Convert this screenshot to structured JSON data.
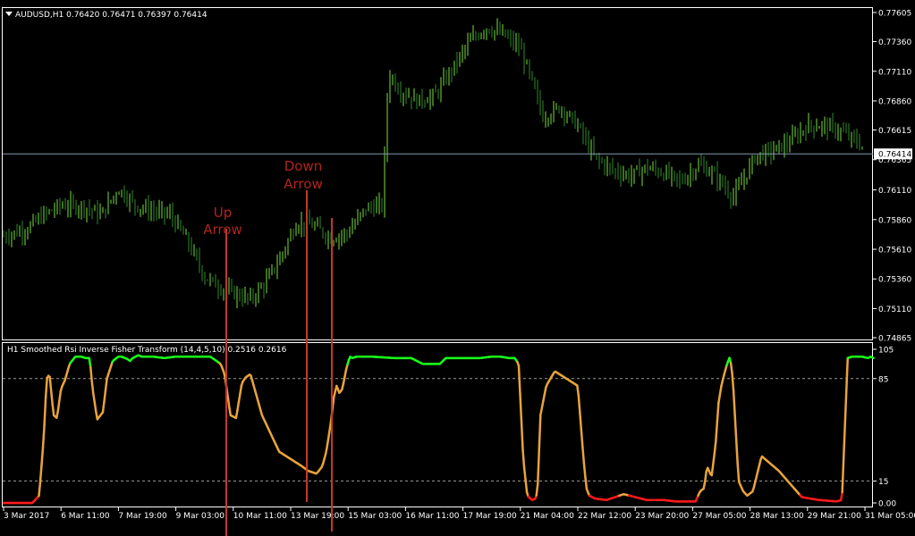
{
  "colors": {
    "background": "#000000",
    "frame": "#ffffff",
    "bull_bar": "#7ddc3c",
    "bear_bar": "#2f8a2a",
    "price_line": "#7f9ab0",
    "high_zone": "#19ff19",
    "mid_zone": "#e8a33a",
    "low_zone": "#ff1a1a",
    "arrow_line": "#c0392b",
    "arrow_text": "#b0241c",
    "level_line": "#9a9a9a"
  },
  "main_header": "AUDUSD,H1  0.76420 0.76471 0.76397 0.76414",
  "indicator_header": "H1 Smoothed Rsi Inverse Fisher Transform (14,4,5,10) 0.2516 0.2616",
  "price_label": "0.76414",
  "annotations": {
    "up_arrow": "Up Arrow",
    "down_arrow": "Down Arrow"
  },
  "chart_data": [
    {
      "type": "ohlc",
      "symbol": "AUDUSD",
      "timeframe": "H1",
      "last_bar": {
        "open": 0.7642,
        "high": 0.76471,
        "low": 0.76397,
        "close": 0.76414
      },
      "current_price": 0.76414,
      "y_ticks": [
        "0.77605",
        "0.77360",
        "0.77110",
        "0.76860",
        "0.76615",
        "0.76365",
        "0.76110",
        "0.75860",
        "0.75610",
        "0.75360",
        "0.75110",
        "0.74865"
      ],
      "ylim": [
        0.74865,
        0.77605
      ],
      "x_ticks": [
        "3 Mar 2017",
        "6 Mar 11:00",
        "7 Mar 19:00",
        "9 Mar 03:00",
        "10 Mar 11:00",
        "13 Mar 19:00",
        "15 Mar 03:00",
        "16 Mar 11:00",
        "17 Mar 19:00",
        "21 Mar 04:00",
        "22 Mar 12:00",
        "23 Mar 20:00",
        "27 Mar 05:00",
        "28 Mar 13:00",
        "29 Mar 21:00",
        "31 Mar 05:00"
      ],
      "x_tick_index": [
        0,
        1,
        2,
        3,
        4,
        5,
        6,
        7,
        8,
        9,
        10,
        11,
        12,
        13,
        14,
        15
      ],
      "close_path": {
        "x": [
          0,
          0.4,
          0.7,
          1.0,
          1.4,
          1.7,
          2.0,
          2.3,
          2.6,
          2.9,
          3.2,
          3.5,
          3.8,
          4.1,
          4.3,
          4.55,
          4.8,
          5.1,
          5.4,
          5.7,
          6.0,
          6.3,
          6.6,
          6.7,
          6.9,
          7.2,
          7.5,
          7.8,
          8.1,
          8.4,
          8.7,
          9.0,
          9.2,
          9.4,
          9.7,
          10.0,
          10.3,
          10.6,
          10.9,
          11.2,
          11.5,
          11.8,
          12.1,
          12.4,
          12.7,
          12.8,
          13.1,
          13.4,
          13.7,
          14.0,
          14.3,
          14.6,
          14.9,
          15.1
        ],
        "y": [
          0.7572,
          0.7578,
          0.759,
          0.7598,
          0.7597,
          0.759,
          0.7612,
          0.7598,
          0.7593,
          0.759,
          0.7568,
          0.7538,
          0.7528,
          0.7522,
          0.7519,
          0.7532,
          0.7552,
          0.7583,
          0.7581,
          0.757,
          0.7575,
          0.7595,
          0.7598,
          0.771,
          0.7695,
          0.7686,
          0.769,
          0.7712,
          0.7735,
          0.7748,
          0.7742,
          0.773,
          0.7702,
          0.7672,
          0.7681,
          0.7665,
          0.7638,
          0.7628,
          0.7623,
          0.763,
          0.7625,
          0.7618,
          0.7632,
          0.7623,
          0.7605,
          0.7612,
          0.764,
          0.7644,
          0.7652,
          0.7665,
          0.7665,
          0.766,
          0.765,
          0.76414
        ]
      }
    },
    {
      "type": "line",
      "title": "H1 Smoothed Rsi Inverse Fisher Transform (14,4,5,10)",
      "ylim": [
        0,
        105
      ],
      "y_ticks": [
        "105",
        "85",
        "15",
        "0.00"
      ],
      "levels": [
        85,
        15
      ],
      "zone_thresholds": {
        "high": 95,
        "low": 5
      },
      "series": [
        {
          "values": {
            "x": [
              0,
              0.5,
              0.62,
              0.7,
              0.75,
              0.8,
              0.87,
              0.93,
              1.0,
              1.07,
              1.15,
              1.25,
              1.35,
              1.43,
              1.5,
              1.55,
              1.63,
              1.73,
              1.8,
              1.9,
              2.0,
              2.05,
              2.12,
              2.17,
              2.2,
              2.25,
              2.35,
              2.4,
              2.6,
              2.8,
              3.0,
              3.2,
              3.4,
              3.6,
              3.78,
              3.85,
              3.95,
              4.05,
              4.15,
              4.22,
              4.3,
              4.5,
              4.8,
              5.0,
              5.2,
              5.3,
              5.45,
              5.55,
              5.62,
              5.7,
              5.75,
              5.8,
              5.85,
              5.9,
              5.97,
              6.03,
              6.07,
              6.15,
              6.4,
              6.8,
              7.1,
              7.3,
              7.45,
              7.6,
              7.7,
              7.9,
              8.1,
              8.3,
              8.5,
              8.65,
              8.8,
              8.9,
              8.97,
              9.05,
              9.12,
              9.2,
              9.27,
              9.3,
              9.35,
              9.45,
              9.6,
              10.0,
              10.1,
              10.15,
              10.2,
              10.3,
              10.5,
              10.8,
              11.2,
              11.5,
              11.7,
              11.85,
              11.9,
              11.97,
              12.05,
              12.13,
              12.2,
              12.25,
              12.33,
              12.4,
              12.45,
              12.5,
              12.55,
              12.6,
              12.65,
              12.7,
              12.8,
              12.88,
              12.95,
              13.05,
              13.2,
              13.5,
              13.9,
              14.2,
              14.5,
              14.6,
              14.7,
              14.78,
              14.85,
              14.95,
              15.05,
              15.1,
              15.15
            ],
            "y": [
              0,
              0,
              5,
              45,
              85,
              88,
              60,
              58,
              78,
              84,
              95,
              100,
              100,
              99,
              99,
              78,
              57,
              62,
              85,
              97,
              100,
              100,
              99,
              98,
              97,
              99,
              101,
              100,
              100,
              99,
              100,
              100,
              100,
              100,
              95,
              88,
              60,
              58,
              82,
              86,
              88,
              60,
              35,
              30,
              25,
              22,
              20,
              25,
              35,
              55,
              72,
              80,
              75,
              78,
              92,
              100,
              99,
              100,
              100,
              99,
              99,
              95,
              95,
              95,
              99,
              99,
              99,
              99,
              100,
              100,
              99,
              99,
              95,
              30,
              5,
              2,
              3,
              10,
              60,
              80,
              90,
              80,
              30,
              10,
              5,
              3,
              2,
              6,
              2,
              2,
              1,
              1,
              1,
              1,
              1,
              8,
              10,
              25,
              18,
              40,
              68,
              80,
              88,
              95,
              100,
              85,
              15,
              8,
              5,
              8,
              32,
              22,
              4,
              2,
              1,
              2,
              99,
              100,
              100,
              100,
              99,
              100,
              99,
              95,
              35,
              2,
              1,
              1
            ]
          }
        }
      ]
    }
  ]
}
